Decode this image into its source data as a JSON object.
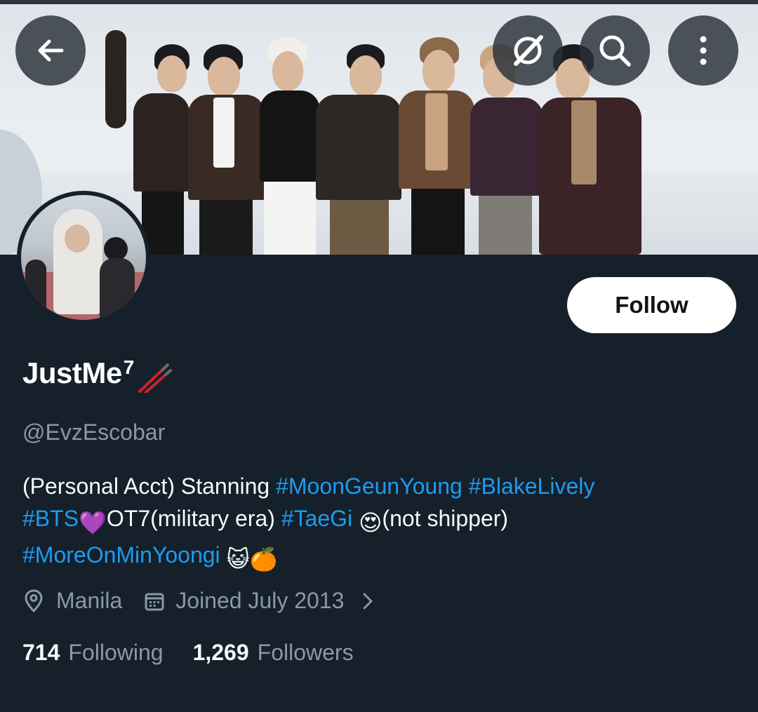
{
  "header": {
    "back_icon": "arrow-left-icon",
    "grok_icon": "grok-icon",
    "search_icon": "search-icon",
    "more_icon": "more-vertical-icon"
  },
  "profile": {
    "display_name": "JustMe",
    "name_superscript": "7",
    "name_emoji": "chopsticks",
    "handle": "@EvzEscobar",
    "follow_label": "Follow",
    "bio": {
      "p1": "(Personal Acct) Stanning ",
      "tag1": "#MoonGeunYoung",
      "p2": " ",
      "tag2": "#BlakeLively",
      "tag3": "#BTS",
      "emoji1": "💜",
      "p3": "OT7(military era) ",
      "tag4": "#TaeGi",
      "emoji2": "😍",
      "p4": "(not shipper)",
      "tag5": "#MoreOnMinYoongi",
      "emoji3": "😺",
      "emoji4": "🍊"
    },
    "location": "Manila",
    "joined": "Joined July 2013",
    "following_count": "714",
    "following_label": "Following",
    "followers_count": "1,269",
    "followers_label": "Followers"
  },
  "colors": {
    "background": "#15202b",
    "accent": "#1d9bf0",
    "muted": "#8b98a5"
  }
}
